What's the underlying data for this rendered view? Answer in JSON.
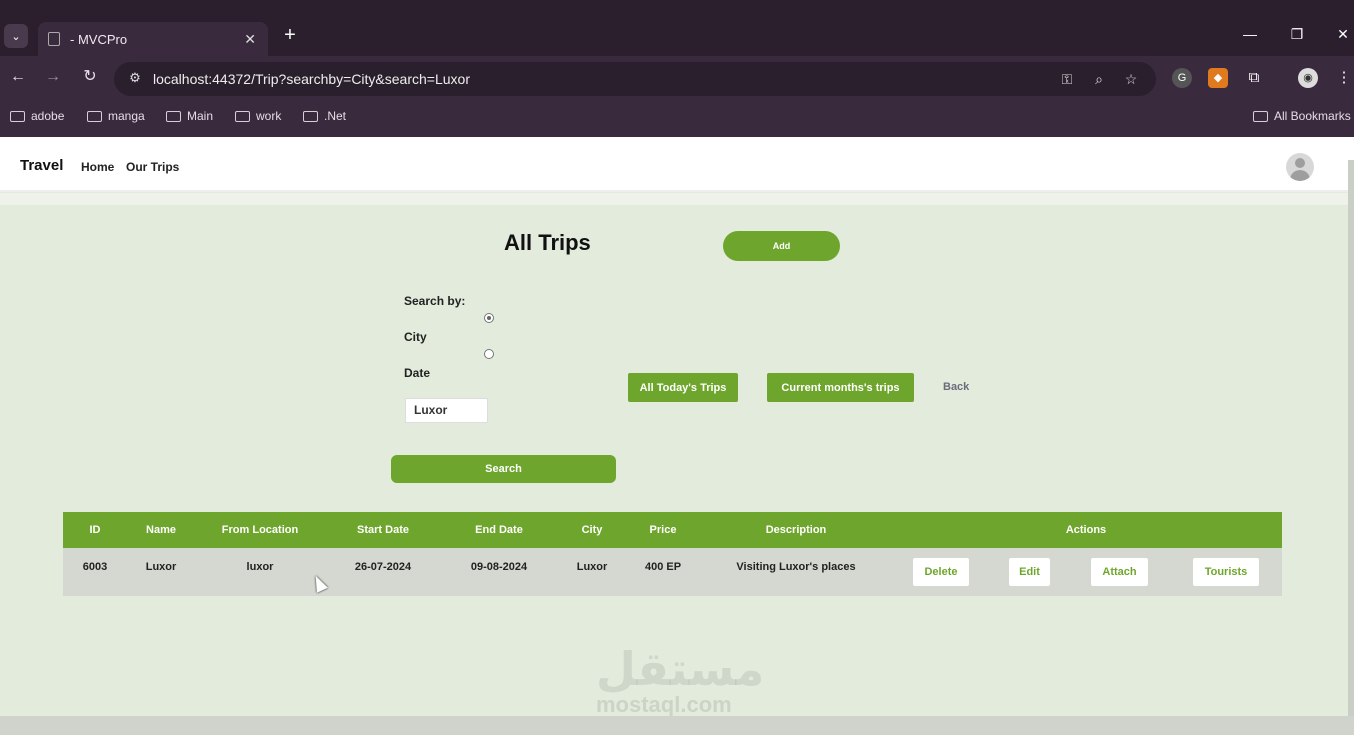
{
  "browser": {
    "tab_title": "- MVCPro",
    "url": "localhost:44372/Trip?searchby=City&search=Luxor",
    "bookmarks": [
      "adobe",
      "manga",
      "Main",
      "work",
      ".Net"
    ],
    "all_bookmarks": "All Bookmarks"
  },
  "header": {
    "brand": "Travel",
    "nav": [
      "Home",
      "Our Trips"
    ]
  },
  "main": {
    "title": "All Trips",
    "add_label": "Add",
    "search_by_label": "Search by:",
    "options": [
      "City",
      "Date"
    ],
    "selected_option": "City",
    "search_value": "Luxor",
    "today_btn": "All Today's Trips",
    "month_btn": "Current months's trips",
    "back_label": "Back",
    "search_btn": "Search"
  },
  "table": {
    "columns": [
      "ID",
      "Name",
      "From Location",
      "Start Date",
      "End Date",
      "City",
      "Price",
      "Description",
      "Actions"
    ],
    "rows": [
      {
        "id": "6003",
        "name": "Luxor",
        "from": "luxor",
        "start": "26-07-2024",
        "end": "09-08-2024",
        "city": "Luxor",
        "price": "400 EP",
        "description": "Visiting Luxor's places",
        "actions": [
          "Delete",
          "Edit",
          "Attach",
          "Tourists"
        ]
      }
    ]
  },
  "watermark": {
    "arabic": "مستقل",
    "latin": "mostaql.com"
  },
  "colors": {
    "accent": "#6ea62d",
    "page_bg": "#e2ebdc",
    "chrome": "#3a2a3e"
  }
}
